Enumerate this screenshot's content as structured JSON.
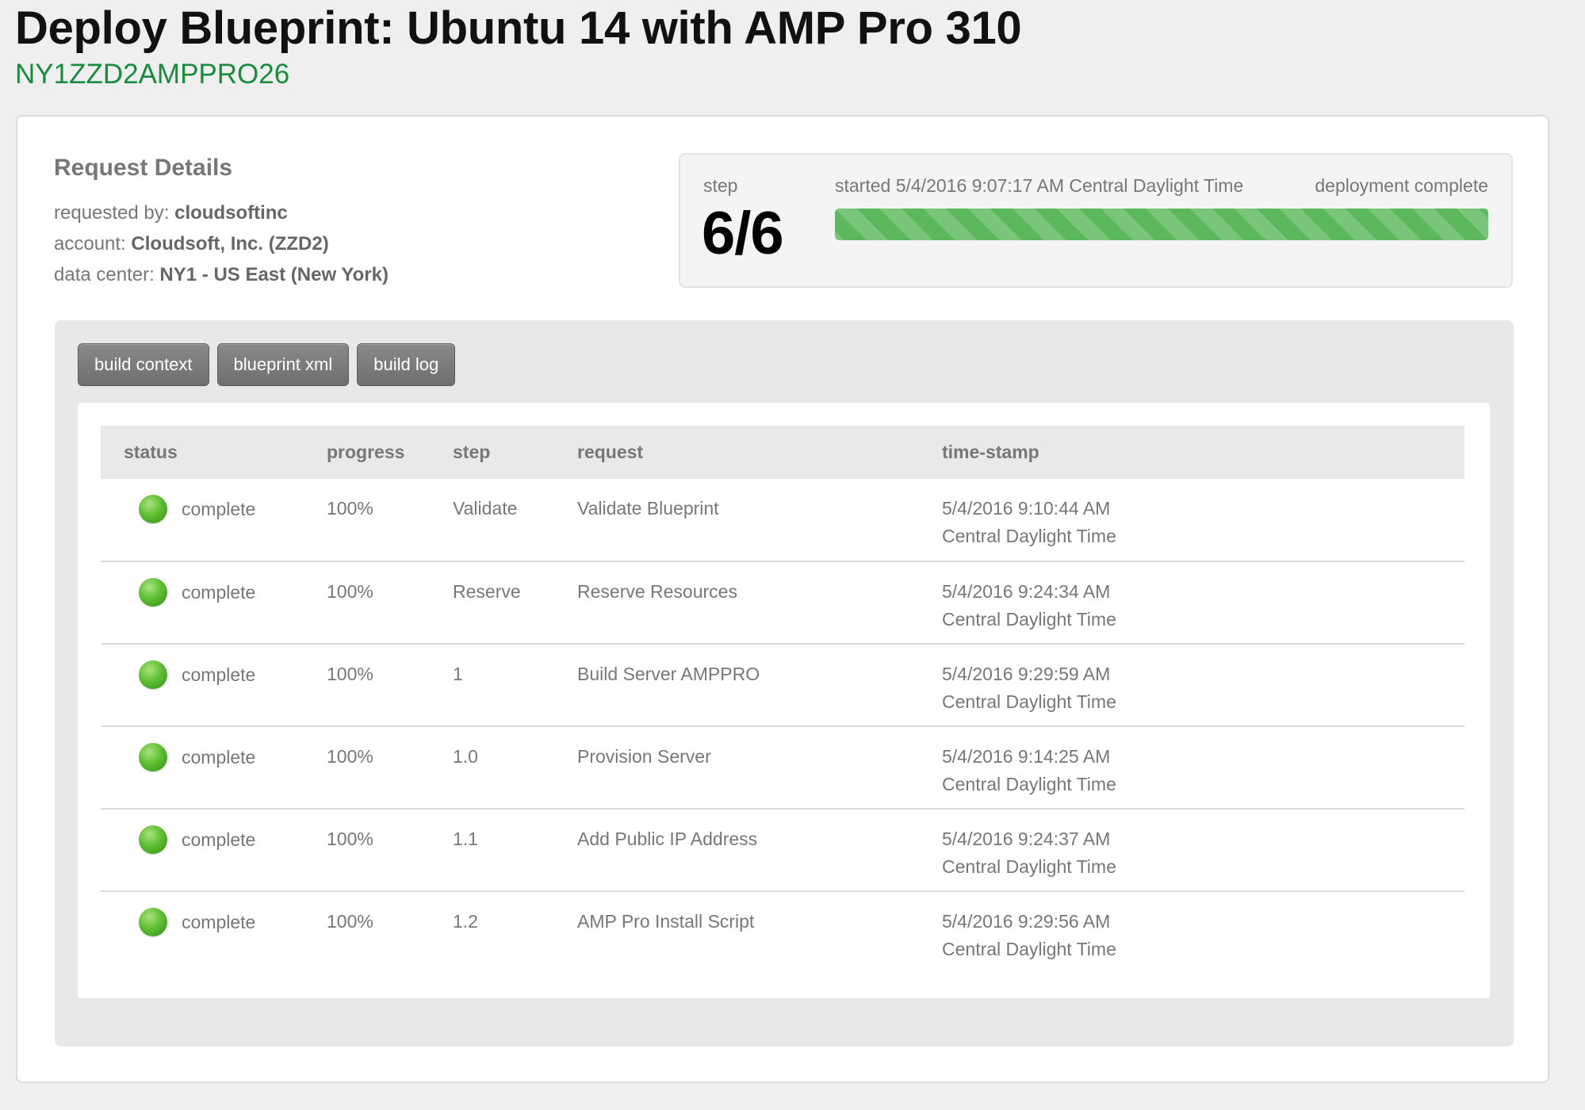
{
  "header": {
    "title": "Deploy Blueprint: Ubuntu 14 with AMP Pro 310",
    "server_name": "NY1ZZD2AMPPRO26"
  },
  "request_details": {
    "heading": "Request Details",
    "requested_by_label": "requested by:",
    "requested_by": "cloudsoftinc",
    "account_label": "account:",
    "account": "Cloudsoft, Inc. (ZZD2)",
    "data_center_label": "data center:",
    "data_center": "NY1 - US East (New York)"
  },
  "progress": {
    "step_label": "step",
    "step_value": "6/6",
    "started": "started 5/4/2016 9:07:17 AM Central Daylight Time",
    "status": "deployment complete",
    "fraction": 1.0,
    "bar_color": "#5cb85c"
  },
  "buttons": {
    "build_context": "build context",
    "blueprint_xml": "blueprint xml",
    "build_log": "build log"
  },
  "table": {
    "headers": {
      "status": "status",
      "progress": "progress",
      "step": "step",
      "request": "request",
      "timestamp": "time-stamp"
    },
    "status_color": "#5fbf32",
    "rows": [
      {
        "status": "complete",
        "progress": "100%",
        "step": "Validate",
        "request": "Validate Blueprint",
        "time": "5/4/2016 9:10:44 AM",
        "tz": "Central Daylight Time"
      },
      {
        "status": "complete",
        "progress": "100%",
        "step": "Reserve",
        "request": "Reserve Resources",
        "time": "5/4/2016 9:24:34 AM",
        "tz": "Central Daylight Time"
      },
      {
        "status": "complete",
        "progress": "100%",
        "step": "1",
        "request": "Build Server AMPPRO",
        "time": "5/4/2016 9:29:59 AM",
        "tz": "Central Daylight Time"
      },
      {
        "status": "complete",
        "progress": "100%",
        "step": "1.0",
        "request": "Provision Server",
        "time": "5/4/2016 9:14:25 AM",
        "tz": "Central Daylight Time"
      },
      {
        "status": "complete",
        "progress": "100%",
        "step": "1.1",
        "request": "Add Public IP Address",
        "time": "5/4/2016 9:24:37 AM",
        "tz": "Central Daylight Time"
      },
      {
        "status": "complete",
        "progress": "100%",
        "step": "1.2",
        "request": "AMP Pro Install Script",
        "time": "5/4/2016 9:29:56 AM",
        "tz": "Central Daylight Time"
      }
    ]
  }
}
